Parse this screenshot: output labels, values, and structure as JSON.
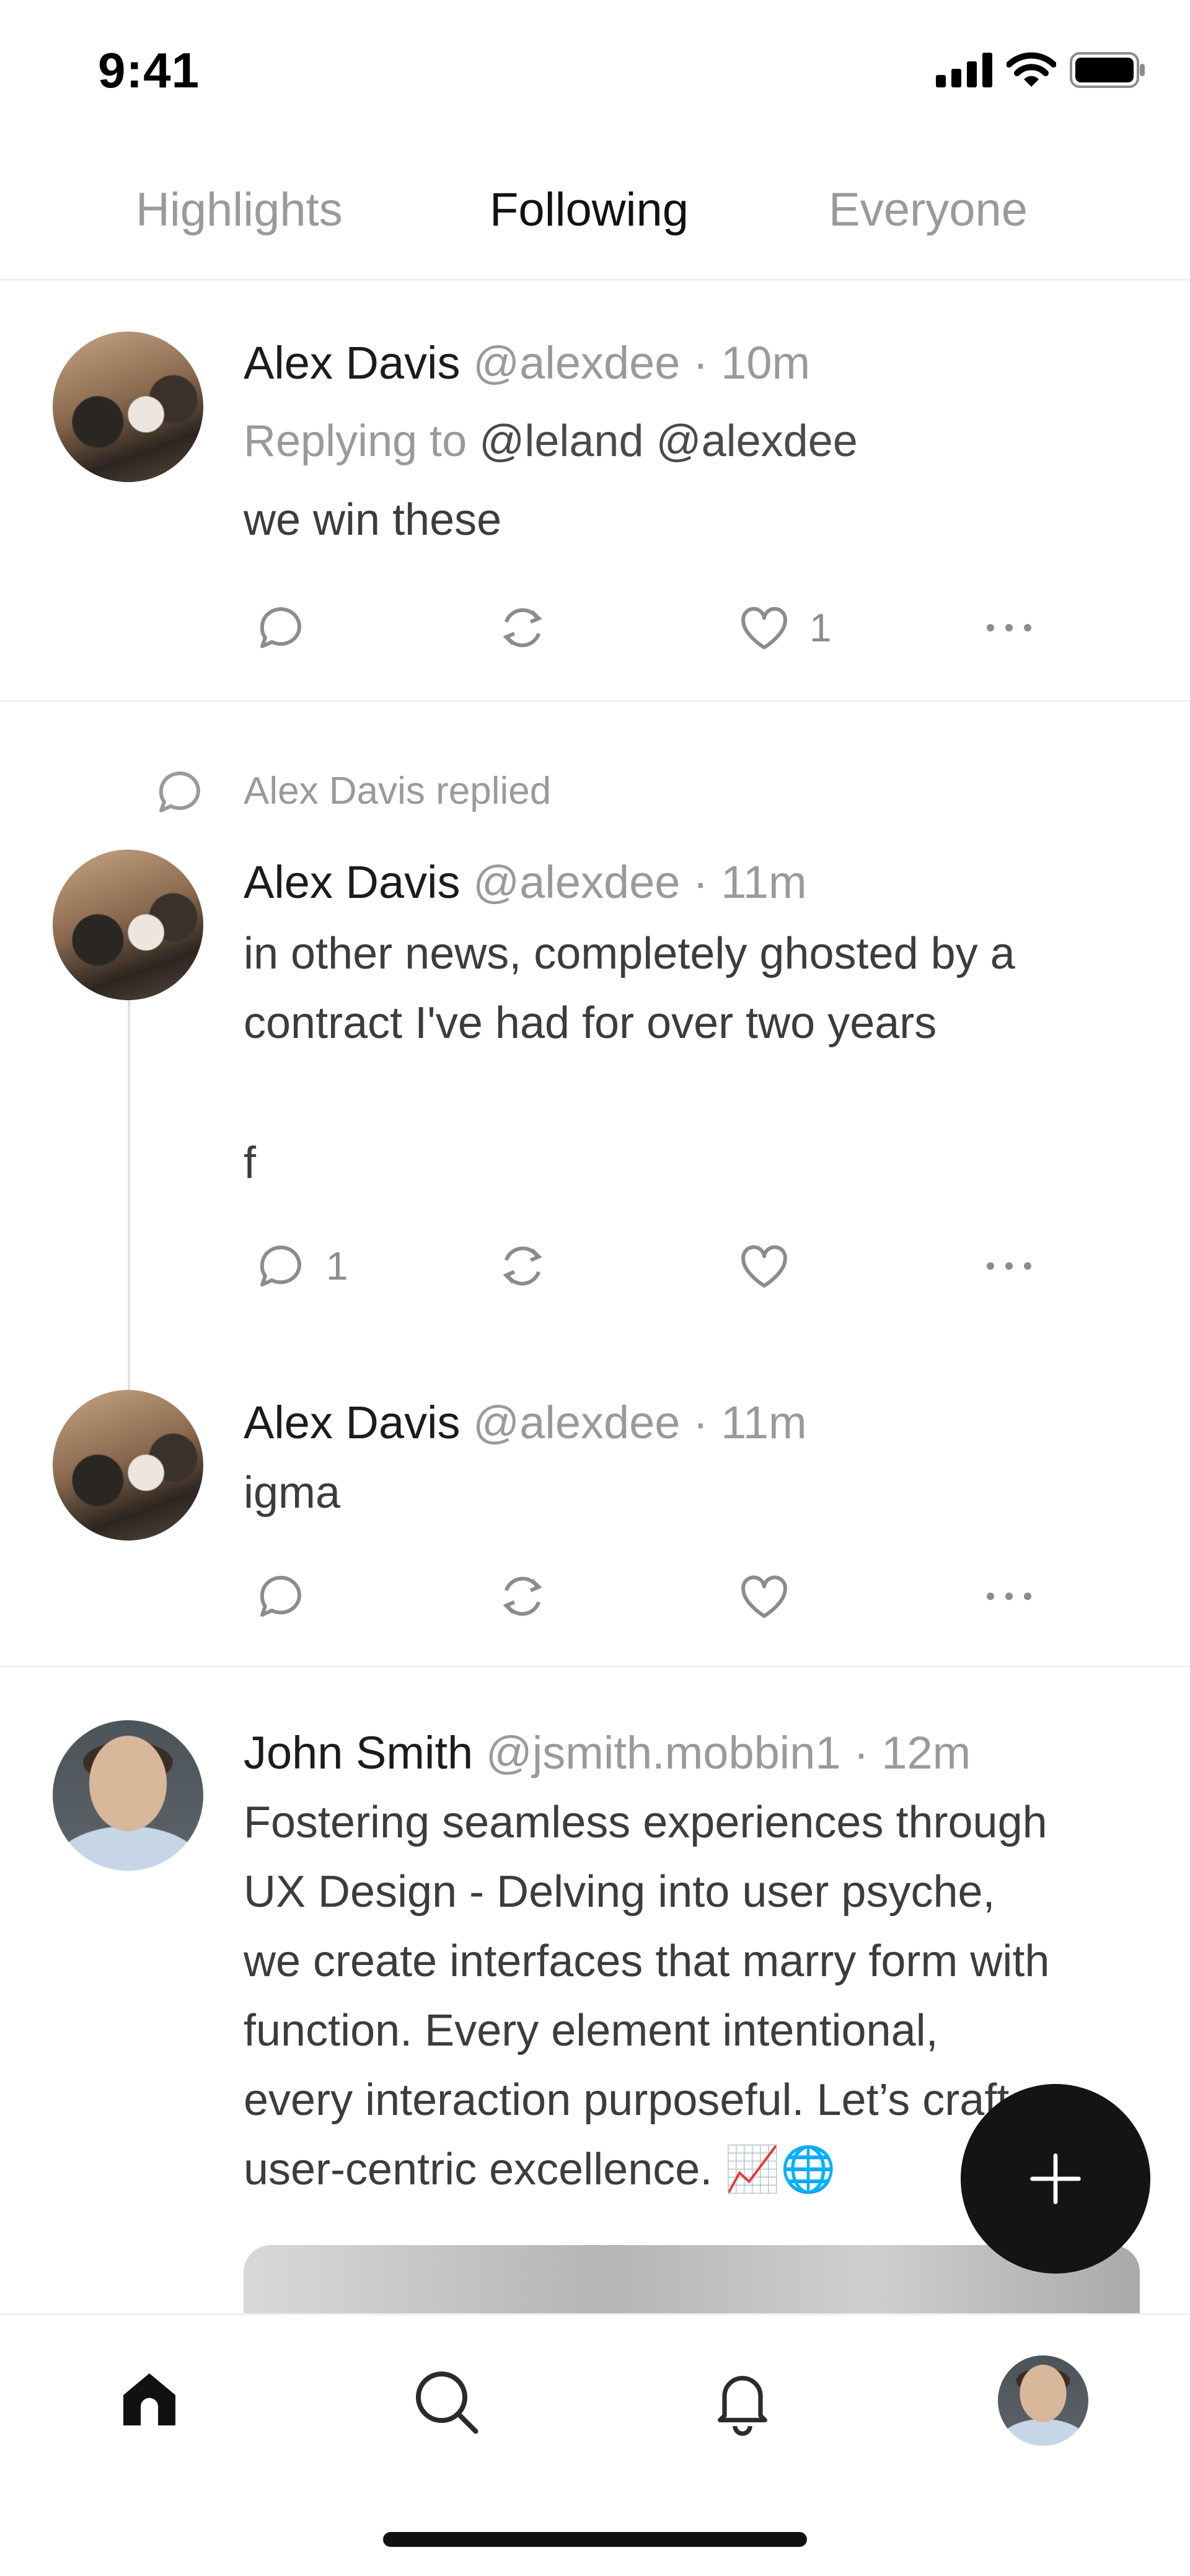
{
  "status_bar": {
    "time": "9:41",
    "icons": [
      "signal-icon",
      "wifi-icon",
      "battery-icon"
    ]
  },
  "tabs": [
    {
      "label": "Highlights",
      "active": false
    },
    {
      "label": "Following",
      "active": true
    },
    {
      "label": "Everyone",
      "active": false
    }
  ],
  "posts": [
    {
      "name": "Alex Davis",
      "handle": "@alexdee",
      "time": "· 10m",
      "replying_prefix": "Replying to",
      "replying_mentions": "@leland @alexdee",
      "text": "we win these",
      "actions": {
        "reply_count": "",
        "like_count": "1"
      }
    },
    {
      "context_label": "Alex Davis replied",
      "name": "Alex Davis",
      "handle": "@alexdee",
      "time": "· 11m",
      "text_line1": "in other news, completely ghosted by a",
      "text_line2": "contract I've had for over two years",
      "text_line3": "f",
      "actions": {
        "reply_count": "1",
        "like_count": ""
      }
    },
    {
      "name": "Alex Davis",
      "handle": "@alexdee",
      "time": "· 11m",
      "text": "igma",
      "actions": {
        "reply_count": "",
        "like_count": ""
      }
    },
    {
      "name": "John Smith",
      "handle": "@jsmith.mobbin1",
      "time": "· 12m",
      "lines": [
        "Fostering seamless experiences through",
        "UX Design - Delving into user psyche,",
        "we create interfaces that marry form with",
        "function. Every element intentional,",
        "every interaction purposeful. Let’s craft",
        "user-centric excellence. 📈🌐"
      ]
    }
  ],
  "fab": {
    "icon": "plus-icon"
  },
  "bottom_nav": [
    "home-icon",
    "search-icon",
    "bell-icon",
    "profile-avatar"
  ],
  "colors": {
    "accent": "#141414",
    "muted": "#9a9a9a",
    "separator": "#efefef"
  }
}
